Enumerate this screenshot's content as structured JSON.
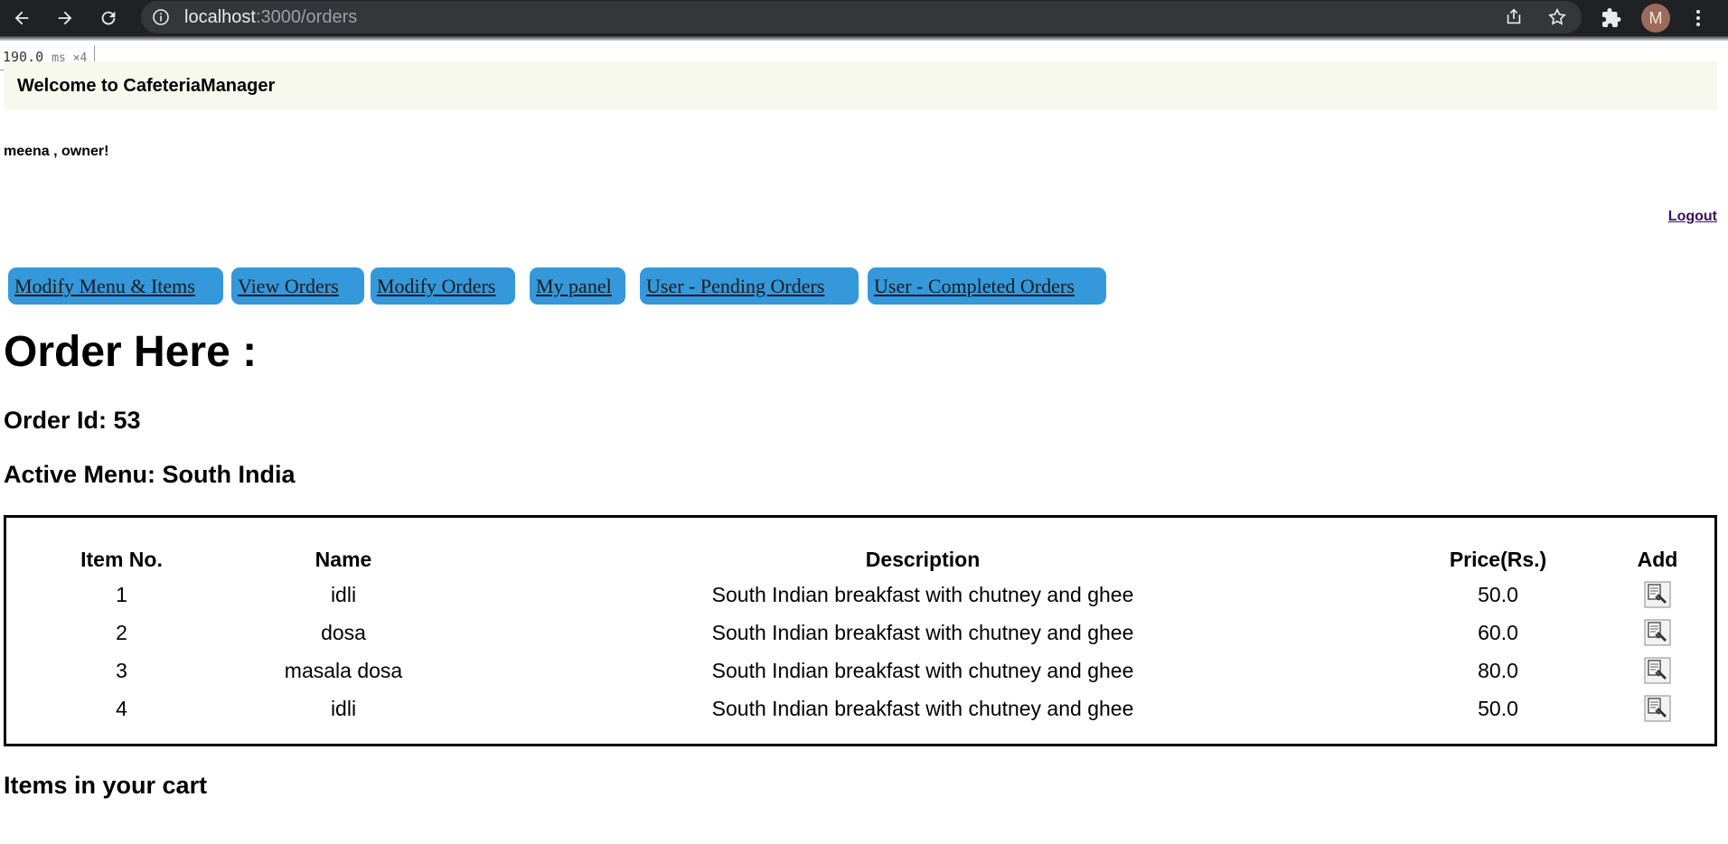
{
  "browser": {
    "url_host": "localhost",
    "url_path": ":3000/orders",
    "avatar_letter": "M"
  },
  "debug": {
    "timing": "190.0",
    "timing_unit": "ms ×4"
  },
  "header": {
    "title": "Welcome to CafeteriaManager"
  },
  "user": {
    "greeting": "meena , owner!"
  },
  "logout_label": "Logout",
  "nav": [
    {
      "label": "Modify Menu & Items "
    },
    {
      "label": "View Orders"
    },
    {
      "label": "Modify Orders"
    },
    {
      "label": "My panel"
    },
    {
      "label": "User - Pending Orders "
    },
    {
      "label": "User - Completed Orders"
    }
  ],
  "page": {
    "heading": "Order Here :",
    "order_id": "Order Id: 53",
    "active_menu": "Active Menu: South India",
    "cart_heading": "Items in your cart"
  },
  "table": {
    "headers": [
      "Item No.",
      "Name",
      "Description",
      "Price(Rs.)",
      "Add"
    ],
    "rows": [
      [
        "1",
        "idli",
        "South Indian breakfast with chutney and ghee",
        "50.0"
      ],
      [
        "2",
        "dosa",
        "South Indian breakfast with chutney and ghee",
        "60.0"
      ],
      [
        "3",
        "masala dosa",
        "South Indian breakfast with chutney and ghee",
        "80.0"
      ],
      [
        "4",
        "idli",
        "South Indian breakfast with chutney and ghee",
        "50.0"
      ]
    ]
  },
  "colors": {
    "nav_button": "#3498db",
    "welcome_bar": "#f8f9ee",
    "logout": "#3b0f5c"
  }
}
